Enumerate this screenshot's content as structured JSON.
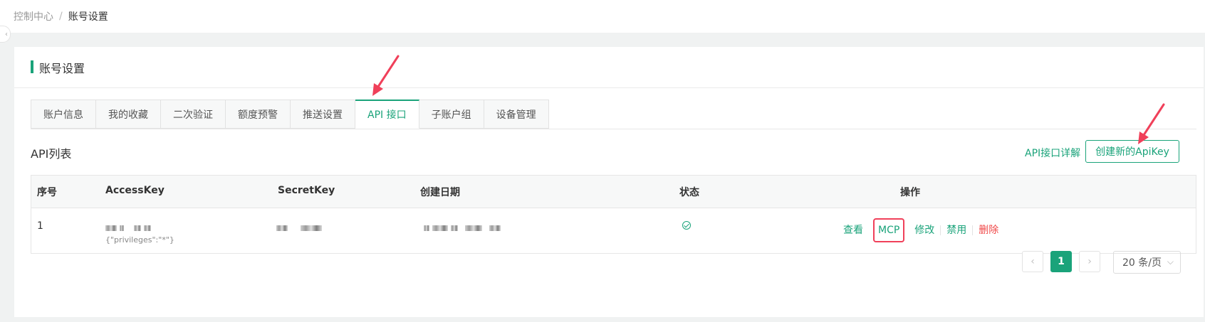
{
  "breadcrumb": {
    "root": "控制中心",
    "separator": "/",
    "current": "账号设置"
  },
  "card": {
    "title": "账号设置"
  },
  "tabs": [
    {
      "label": "账户信息"
    },
    {
      "label": "我的收藏"
    },
    {
      "label": "二次验证"
    },
    {
      "label": "额度预警"
    },
    {
      "label": "推送设置"
    },
    {
      "label": "API 接口",
      "active": true
    },
    {
      "label": "子账户组"
    },
    {
      "label": "设备管理"
    }
  ],
  "section": {
    "title": "API列表",
    "doc_link": "API接口详解",
    "create_button": "创建新的ApiKey"
  },
  "table": {
    "columns": [
      "序号",
      "AccessKey",
      "SecretKey",
      "创建日期",
      "状态",
      "操作"
    ],
    "rows": [
      {
        "index": "1",
        "access_note": "{\"privileges\":\"*\"}",
        "actions": [
          "查看",
          "MCP",
          "修改",
          "禁用",
          "删除"
        ]
      }
    ]
  },
  "pagination": {
    "current_page": "1",
    "page_size": "20 条/页",
    "prev": "‹",
    "next": "›"
  },
  "colors": {
    "accent": "#1aa37a",
    "danger": "#f04848",
    "annotation": "#f0405a"
  }
}
